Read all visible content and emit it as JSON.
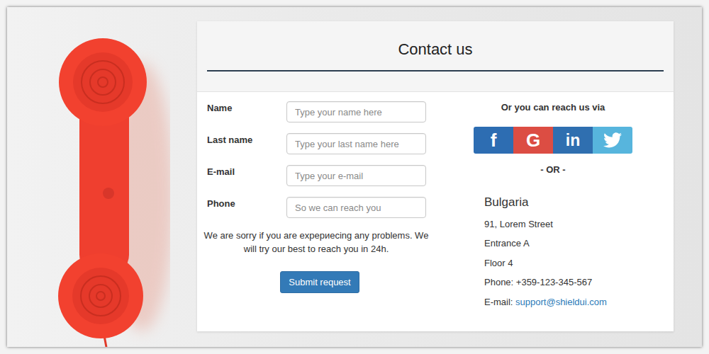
{
  "header": {
    "title": "Contact us"
  },
  "form": {
    "fields": [
      {
        "label": "Name",
        "placeholder": "Type your name here"
      },
      {
        "label": "Last name",
        "placeholder": "Type your last name here"
      },
      {
        "label": "E-mail",
        "placeholder": "Type your e-mail"
      },
      {
        "label": "Phone",
        "placeholder": "So we can reach you"
      }
    ],
    "message": "We are sorry if you are expериecing any problems. We will try our best to reach you in 24h.",
    "submit": "Submit request"
  },
  "contact": {
    "heading": "Or you can reach us via",
    "social": [
      {
        "kind": "text",
        "glyph": "f",
        "color": "#2d6db2"
      },
      {
        "kind": "text",
        "glyph": "G",
        "color": "#dc4d43"
      },
      {
        "kind": "text",
        "glyph": "in",
        "color": "#2f6fb0"
      },
      {
        "kind": "icon",
        "glyph": "",
        "color": "#57b5dd"
      }
    ],
    "separator": "- OR -",
    "country": "Bulgaria",
    "address_lines": [
      "91, Lorem Street",
      "Entrance A",
      "Floor 4",
      "Phone: +359-123-345-567"
    ],
    "email": {
      "label": "E-mail:",
      "address": "support@shieldui.com"
    }
  }
}
